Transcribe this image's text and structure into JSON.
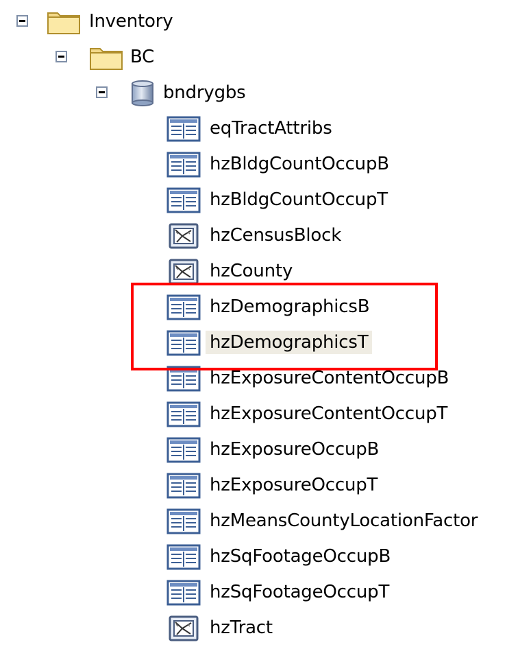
{
  "tree": {
    "root": {
      "label": "Inventory",
      "icon": "folder-open-icon",
      "expanded": true
    },
    "folder": {
      "label": "BC",
      "icon": "folder-open-icon",
      "expanded": true
    },
    "database": {
      "label": "bndrygbs",
      "icon": "database-icon",
      "expanded": true
    },
    "items": [
      {
        "label": "eqTractAttribs",
        "icon": "table-icon"
      },
      {
        "label": "hzBldgCountOccupB",
        "icon": "table-icon"
      },
      {
        "label": "hzBldgCountOccupT",
        "icon": "table-icon"
      },
      {
        "label": "hzCensusBlock",
        "icon": "polygon-feature-class-icon"
      },
      {
        "label": "hzCounty",
        "icon": "polygon-feature-class-icon"
      },
      {
        "label": "hzDemographicsB",
        "icon": "table-icon"
      },
      {
        "label": "hzDemographicsT",
        "icon": "table-icon",
        "selected": true
      },
      {
        "label": "hzExposureContentOccupB",
        "icon": "table-icon"
      },
      {
        "label": "hzExposureContentOccupT",
        "icon": "table-icon"
      },
      {
        "label": "hzExposureOccupB",
        "icon": "table-icon"
      },
      {
        "label": "hzExposureOccupT",
        "icon": "table-icon"
      },
      {
        "label": "hzMeansCountyLocationFactor",
        "icon": "table-icon"
      },
      {
        "label": "hzSqFootageOccupB",
        "icon": "table-icon"
      },
      {
        "label": "hzSqFootageOccupT",
        "icon": "table-icon"
      },
      {
        "label": "hzTract",
        "icon": "polygon-feature-class-icon"
      }
    ]
  },
  "annotation": {
    "color": "#ff0000"
  }
}
